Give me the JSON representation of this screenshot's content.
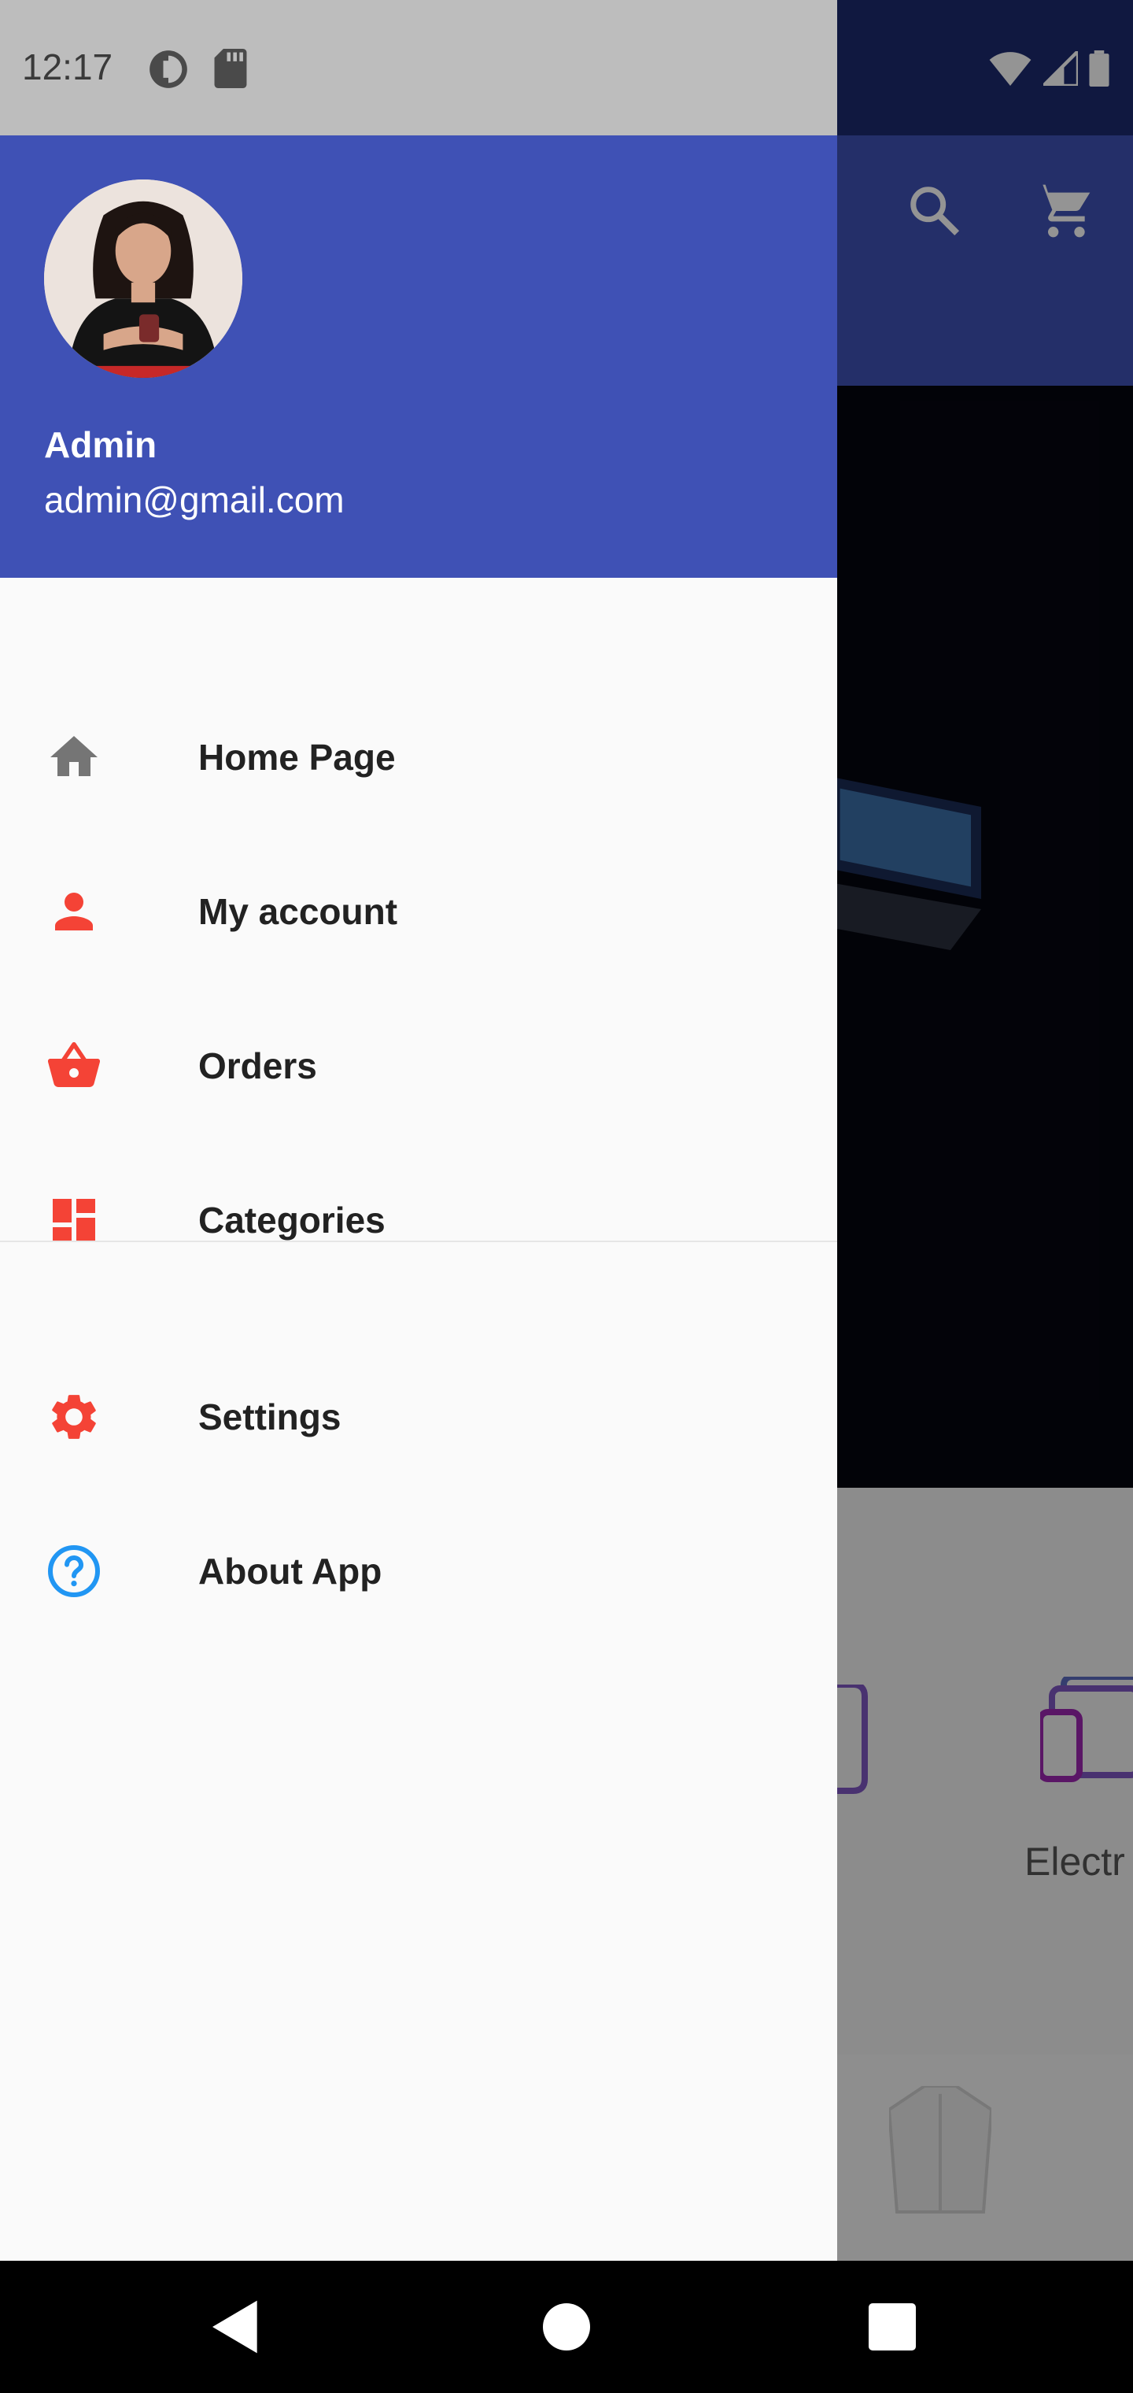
{
  "status_bar": {
    "time": "12:17",
    "icons": [
      "data-saver-icon",
      "sd-card-icon",
      "wifi-icon",
      "signal-icon",
      "battery-icon"
    ]
  },
  "drawer": {
    "header": {
      "name": "Admin",
      "email": "admin@gmail.com",
      "background_color": "#3f51b5"
    },
    "items": [
      {
        "label": "Home Page",
        "icon": "home-icon",
        "color": "#757575"
      },
      {
        "label": "My account",
        "icon": "person-icon",
        "color": "#f44336"
      },
      {
        "label": "Orders",
        "icon": "basket-icon",
        "color": "#f44336"
      },
      {
        "label": "Categories",
        "icon": "dashboard-icon",
        "color": "#f44336"
      },
      {
        "label": "Settings",
        "icon": "gear-icon",
        "color": "#f44336"
      },
      {
        "label": "About App",
        "icon": "help-circle-icon",
        "color": "#2196f3"
      }
    ]
  },
  "background_app": {
    "toolbar_icons": [
      "search-icon",
      "cart-icon"
    ],
    "category_label_partial": "Electr"
  },
  "navigation_bar": {
    "buttons": [
      "back-button",
      "home-button",
      "recents-button"
    ]
  }
}
